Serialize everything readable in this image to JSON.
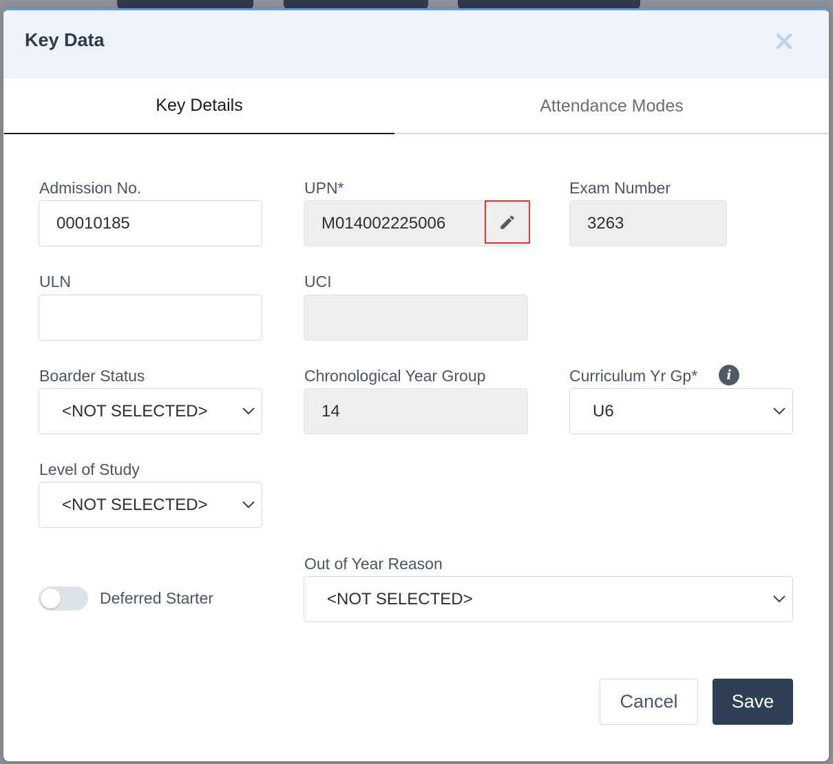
{
  "modal": {
    "title": "Key Data",
    "close_icon": "close-icon"
  },
  "tabs": [
    {
      "label": "Key Details",
      "active": true
    },
    {
      "label": "Attendance Modes",
      "active": false
    }
  ],
  "fields": {
    "admission_no": {
      "label": "Admission No.",
      "value": "00010185"
    },
    "upn": {
      "label": "UPN*",
      "value": "M014002225006",
      "icon": "pencil-icon"
    },
    "exam_number": {
      "label": "Exam Number",
      "value": "3263"
    },
    "uln": {
      "label": "ULN",
      "value": ""
    },
    "uci": {
      "label": "UCI",
      "value": ""
    },
    "boarder_status": {
      "label": "Boarder Status",
      "value": "<NOT SELECTED>"
    },
    "chronological_year_group": {
      "label": "Chronological Year Group",
      "value": "14"
    },
    "curriculum_yr_gp": {
      "label": "Curriculum Yr Gp*",
      "value": "U6",
      "icon": "info-icon"
    },
    "level_of_study": {
      "label": "Level of Study",
      "value": "<NOT SELECTED>"
    },
    "out_of_year_reason": {
      "label": "Out of Year Reason",
      "value": "<NOT SELECTED>"
    }
  },
  "deferred_starter": {
    "label": "Deferred Starter",
    "on": false
  },
  "buttons": {
    "cancel": "Cancel",
    "save": "Save"
  },
  "colors": {
    "header_bg": "#eef3f9",
    "primary": "#2e3f56",
    "highlight": "#e4371f",
    "accent_top": "#5b9de5"
  }
}
